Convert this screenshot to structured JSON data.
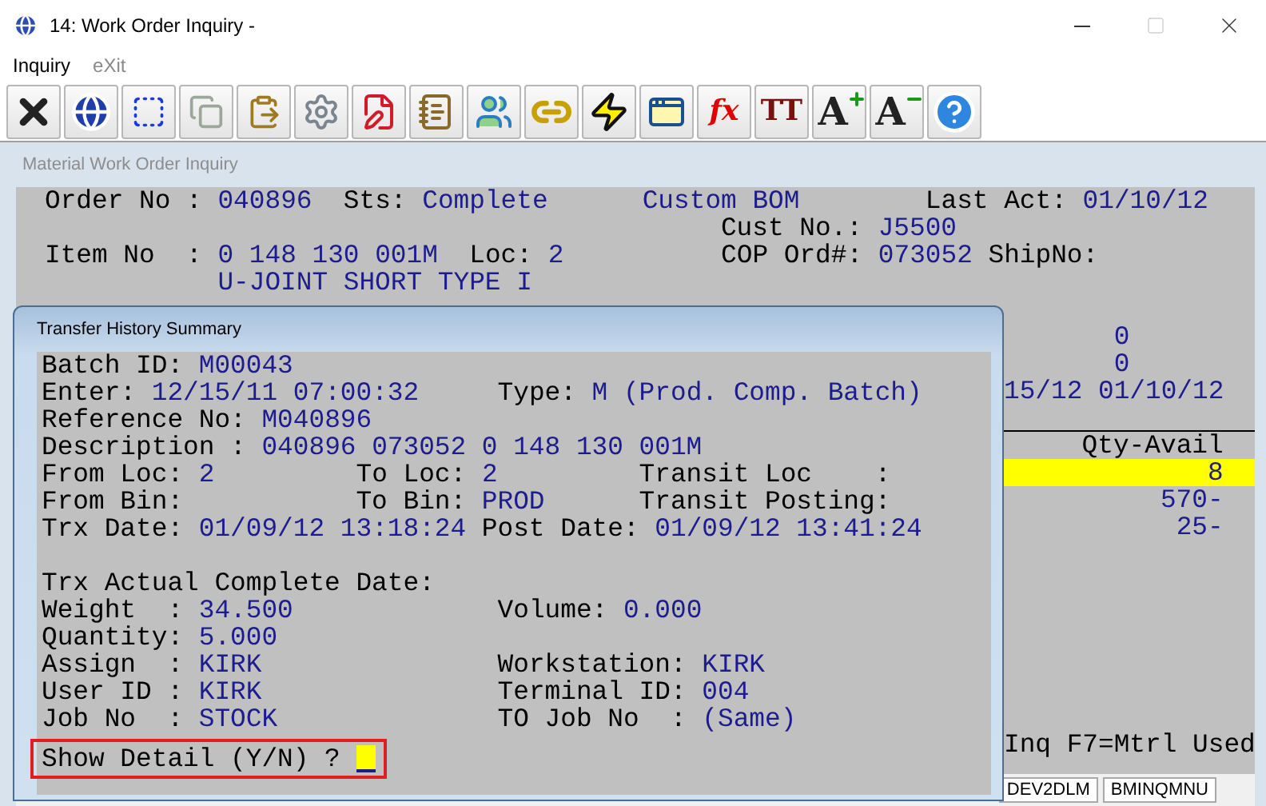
{
  "window": {
    "title": "14: Work Order Inquiry -"
  },
  "menu": [
    {
      "label": "Inquiry",
      "disabled": false
    },
    {
      "label": "eXit",
      "disabled": true
    }
  ],
  "toolbar": [
    {
      "kind": "close"
    },
    {
      "kind": "globe"
    },
    {
      "kind": "select"
    },
    {
      "kind": "copy"
    },
    {
      "kind": "paste"
    },
    {
      "kind": "gear"
    },
    {
      "kind": "edit"
    },
    {
      "kind": "notes"
    },
    {
      "kind": "users"
    },
    {
      "kind": "link"
    },
    {
      "kind": "bolt"
    },
    {
      "kind": "window-bolt"
    },
    {
      "kind": "glyph",
      "glyph": "fx"
    },
    {
      "kind": "glyph",
      "glyph": "TT"
    },
    {
      "kind": "font-up",
      "glyph": "A"
    },
    {
      "kind": "font-down",
      "glyph": "A"
    },
    {
      "kind": "help"
    }
  ],
  "inquiry": {
    "title": "Material Work Order Inquiry",
    "header_lines": [
      [
        {
          "label": "Order No :",
          "value": "040896"
        },
        {
          "label": "Sts:",
          "value": "Complete"
        },
        {
          "value": "Custom BOM"
        },
        {
          "label": "Last Act:",
          "value": "01/10/12"
        }
      ],
      [
        {
          "label": "Cust No.:",
          "value": "J5500"
        }
      ],
      [
        {
          "label": "Item No  :",
          "value": "0 148 130 001M"
        },
        {
          "label": "Loc:",
          "value": "2"
        },
        {
          "label": "COP Ord#:",
          "value": "073052"
        },
        {
          "label": "ShipNo:"
        }
      ],
      [
        {
          "value": "U-JOINT SHORT TYPE I"
        }
      ]
    ],
    "counts": [
      "0",
      "0"
    ],
    "dates": "15/12 01/10/12",
    "table": {
      "column": "Qty-Avail",
      "rows": [
        {
          "value": "8",
          "selected": true
        },
        {
          "value": "570-",
          "selected": false
        },
        {
          "value": "25-",
          "selected": false
        }
      ]
    },
    "key_hint": "Inq F7=Mtrl Used"
  },
  "dialog": {
    "title": "Transfer History Summary",
    "summary_lines": [
      [
        {
          "label": "Batch ID:",
          "value": "M00043"
        }
      ],
      [
        {
          "label": "Enter:",
          "value": "12/15/11 07:00:32"
        },
        {
          "label": "Type:",
          "value": "M (Prod. Comp. Batch)"
        }
      ],
      [
        {
          "label": "Reference No:",
          "value": "M040896"
        }
      ],
      [
        {
          "label": "Description :",
          "value": "040896 073052 0 148 130 001M"
        }
      ],
      [
        {
          "label": "From Loc:",
          "value": "2"
        },
        {
          "label": "To Loc:",
          "value": "2"
        },
        {
          "label": "Transit Loc    :"
        }
      ],
      [
        {
          "label": "From Bin:"
        },
        {
          "label": "To Bin:",
          "value": "PROD"
        },
        {
          "label": "Transit Posting:"
        }
      ],
      [
        {
          "label": "Trx Date:",
          "value": "01/09/12 13:18:24"
        },
        {
          "label": "Post Date:",
          "value": "01/09/12 13:41:24"
        }
      ]
    ],
    "actual_lines": [
      [
        {
          "label": "Trx Actual Complete Date:"
        }
      ],
      [
        {
          "label": "Weight  :",
          "value": "34.500"
        },
        {
          "label": "Volume:",
          "value": "0.000"
        }
      ],
      [
        {
          "label": "Quantity:",
          "value": "5.000"
        }
      ],
      [
        {
          "label": "Assign  :",
          "value": "KIRK"
        },
        {
          "label": "Workstation:",
          "value": "KIRK"
        }
      ],
      [
        {
          "label": "User ID :",
          "value": "KIRK"
        },
        {
          "label": "Terminal ID:",
          "value": "004"
        }
      ],
      [
        {
          "label": "Job No  :",
          "value": "STOCK"
        },
        {
          "label": "TO Job No  :",
          "value": "(Same)"
        }
      ]
    ],
    "prompt": "Show Detail (Y/N) ?"
  },
  "status_bar": [
    "DEV2DLM",
    "BMINQMNU"
  ]
}
